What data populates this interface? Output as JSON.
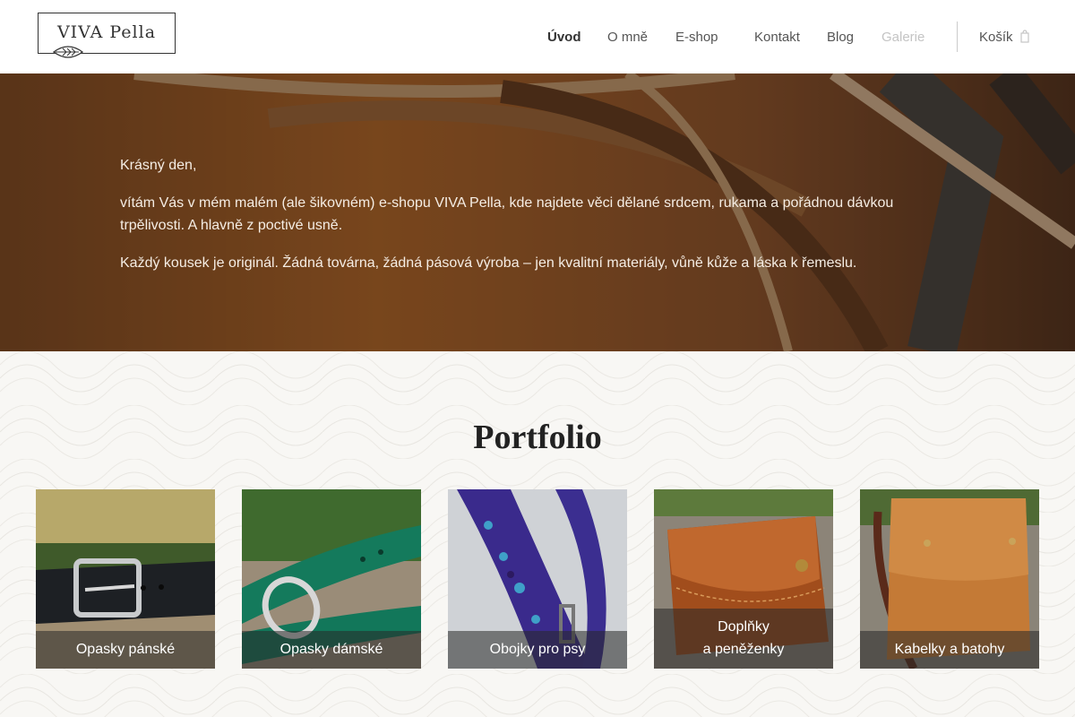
{
  "brand": {
    "name": "VIVA Pella"
  },
  "nav": {
    "items": [
      {
        "label": "Úvod"
      },
      {
        "label": "O mně"
      },
      {
        "label": "E-shop"
      },
      {
        "label": "Kontakt"
      },
      {
        "label": "Blog"
      },
      {
        "label": "Galerie"
      }
    ],
    "cart_label": "Košík"
  },
  "hero": {
    "paragraphs": [
      "Krásný den,",
      "vítám Vás v mém malém (ale šikovném) e-shopu VIVA Pella, kde najdete věci dělané srdcem, rukama a pořádnou dávkou trpělivosti. A hlavně z poctivé usně.",
      "Každý kousek je originál. Žádná továrna, žádná pásová výroba – jen kvalitní materiály, vůně kůže a láska k řemeslu."
    ]
  },
  "portfolio": {
    "title": "Portfolio",
    "cards": [
      {
        "label": "Opasky pánské"
      },
      {
        "label": "Opasky dámské"
      },
      {
        "label": "Obojky pro psy"
      },
      {
        "label_line1": "Doplňky",
        "label_line2": "a peněženky"
      },
      {
        "label": "Kabelky a batohy"
      }
    ]
  },
  "colors": {
    "hero_overlay": "#5a3a20",
    "leather": "#b5692a",
    "label_bg": "#3a3a3a"
  }
}
